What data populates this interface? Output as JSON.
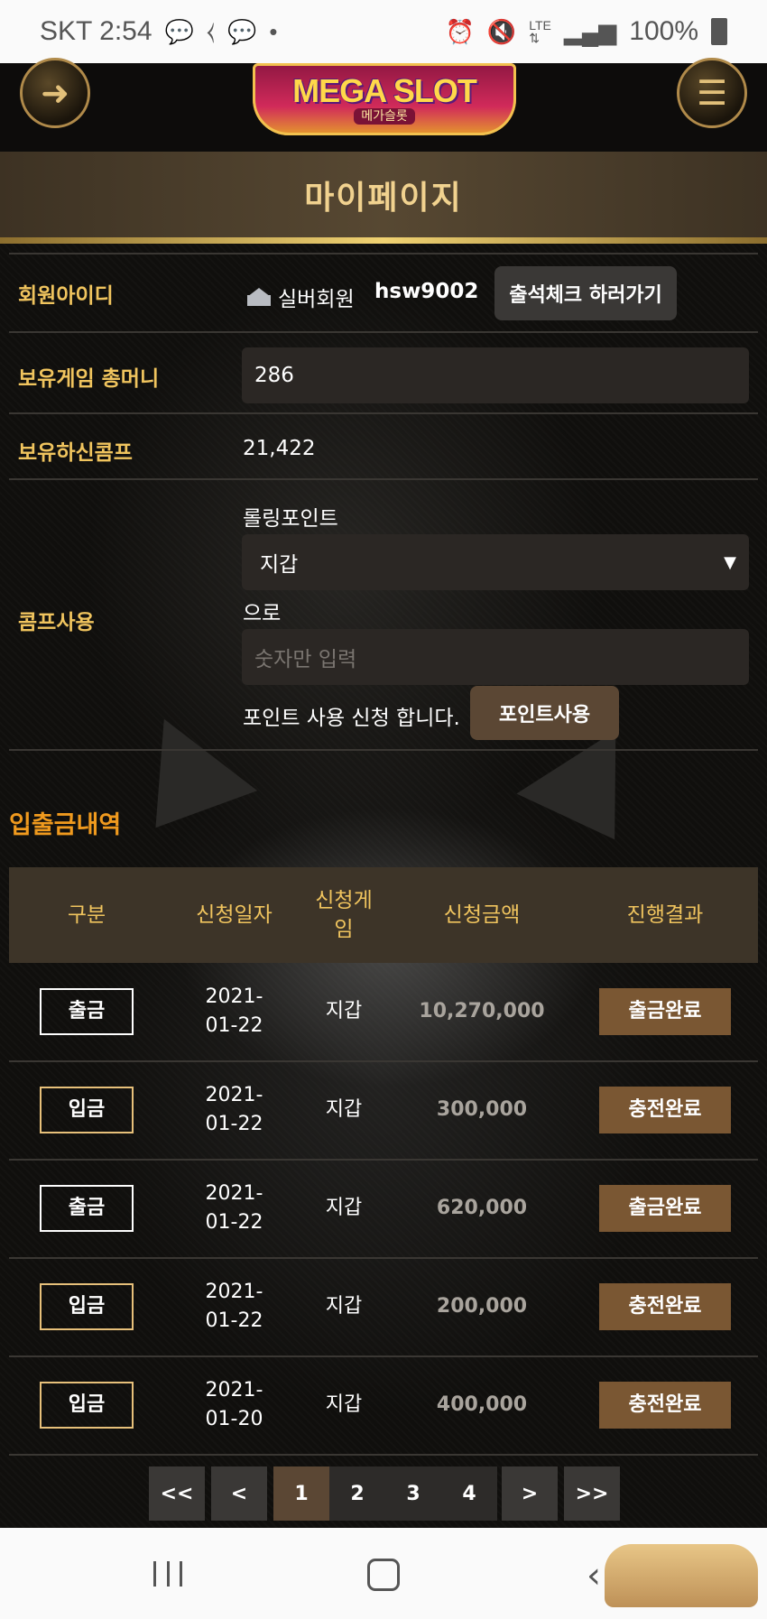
{
  "status_bar": {
    "carrier_time": "SKT 2:54",
    "left_icons": [
      "won-talk-icon",
      "k-icon",
      "talk-icon",
      "dot"
    ],
    "right_icons": [
      "alarm-icon",
      "mute-icon",
      "lte-icon",
      "signal-icon"
    ],
    "battery": "100%"
  },
  "header": {
    "logo_text": "MEGA SLOT",
    "logo_sub": "메가슬롯",
    "left_button_icon": "login-icon",
    "right_button_icon": "menu-icon"
  },
  "page_title": "마이페이지",
  "member": {
    "id_label": "회원아이디",
    "grade": "실버회원",
    "user_id": "hsw9002",
    "attendance_button": "출석체크 하러가기"
  },
  "game_money": {
    "label": "보유게임 총머니",
    "value": "286"
  },
  "comp": {
    "label": "보유하신콤프",
    "value": "21,422"
  },
  "comp_use": {
    "label": "콤프사용",
    "rolling_label": "롤링포인트",
    "select_value": "지갑",
    "to_label": "으로",
    "input_placeholder": "숫자만 입력",
    "request_text": "포인트 사용 신청 합니다.",
    "use_button": "포인트사용"
  },
  "history": {
    "title": "입출금내역",
    "headers": [
      "구분",
      "신청일자",
      "신청게임",
      "신청금액",
      "진행결과"
    ],
    "header_game_lines": [
      "신청게",
      "임"
    ],
    "rows": [
      {
        "type": "출금",
        "kind": "out",
        "date_1": "2021-",
        "date_2": "01-22",
        "game": "지갑",
        "amount": "10,270,000",
        "status": "출금완료"
      },
      {
        "type": "입금",
        "kind": "in",
        "date_1": "2021-",
        "date_2": "01-22",
        "game": "지갑",
        "amount": "300,000",
        "status": "충전완료"
      },
      {
        "type": "출금",
        "kind": "out",
        "date_1": "2021-",
        "date_2": "01-22",
        "game": "지갑",
        "amount": "620,000",
        "status": "출금완료"
      },
      {
        "type": "입금",
        "kind": "in",
        "date_1": "2021-",
        "date_2": "01-22",
        "game": "지갑",
        "amount": "200,000",
        "status": "충전완료"
      },
      {
        "type": "입금",
        "kind": "in",
        "date_1": "2021-",
        "date_2": "01-20",
        "game": "지갑",
        "amount": "400,000",
        "status": "충전완료"
      }
    ]
  },
  "pagination": {
    "first": "<<",
    "prev": "<",
    "pages": [
      "1",
      "2",
      "3",
      "4"
    ],
    "current": "1",
    "next": ">",
    "last": ">>"
  },
  "colors": {
    "gold": "#f0c45e",
    "section_orange": "#f09a1e",
    "status_brown": "#7a5733"
  }
}
